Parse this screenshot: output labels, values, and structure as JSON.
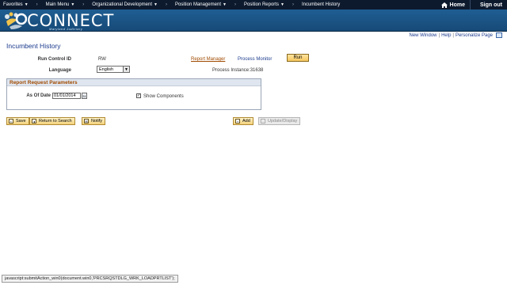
{
  "nav": {
    "items": [
      {
        "label": "Favorites",
        "dropdown": true
      },
      {
        "label": "Main Menu",
        "dropdown": true
      },
      {
        "label": "Organizational Development",
        "dropdown": true
      },
      {
        "label": "Position Management",
        "dropdown": true
      },
      {
        "label": "Position Reports",
        "dropdown": true
      },
      {
        "label": "Incumbent History",
        "dropdown": false
      }
    ],
    "home": "Home",
    "signout": "Sign out"
  },
  "banner": {
    "logo_text": "CONNECT",
    "logo_sub": "Maryland Judiciary"
  },
  "page_links": {
    "new_window": "New Window",
    "help": "Help",
    "personalize": "Personalize Page"
  },
  "page_title": "Incumbent History",
  "form": {
    "run_control_label": "Run Control ID",
    "run_control_value": "RW",
    "report_manager": "Report Manager",
    "process_monitor": "Process Monitor",
    "run_button": "Run",
    "language_label": "Language",
    "language_value": "English",
    "process_instance": "Process Instance:31638"
  },
  "params": {
    "header": "Report Request Parameters",
    "as_of_date_label": "As Of Date",
    "as_of_date_value": "01/01/2014",
    "show_components_label": "Show Components",
    "show_components_checked": true
  },
  "toolbar": {
    "save": "Save",
    "return_to_search": "Return to Search",
    "notify": "Notify",
    "add": "Add",
    "update_display": "Update/Display"
  },
  "status_bar": "javascript:submitAction_win0(document.win0,'PRCSRQSTDLG_WRK_LOADPRTLIST');",
  "colors": {
    "nav_bg": "#0d1a2e",
    "banner": "#1f5e93",
    "link_blue": "#1a3a8c",
    "link_orange": "#a04a00",
    "button_gold": "#f3d27a"
  }
}
